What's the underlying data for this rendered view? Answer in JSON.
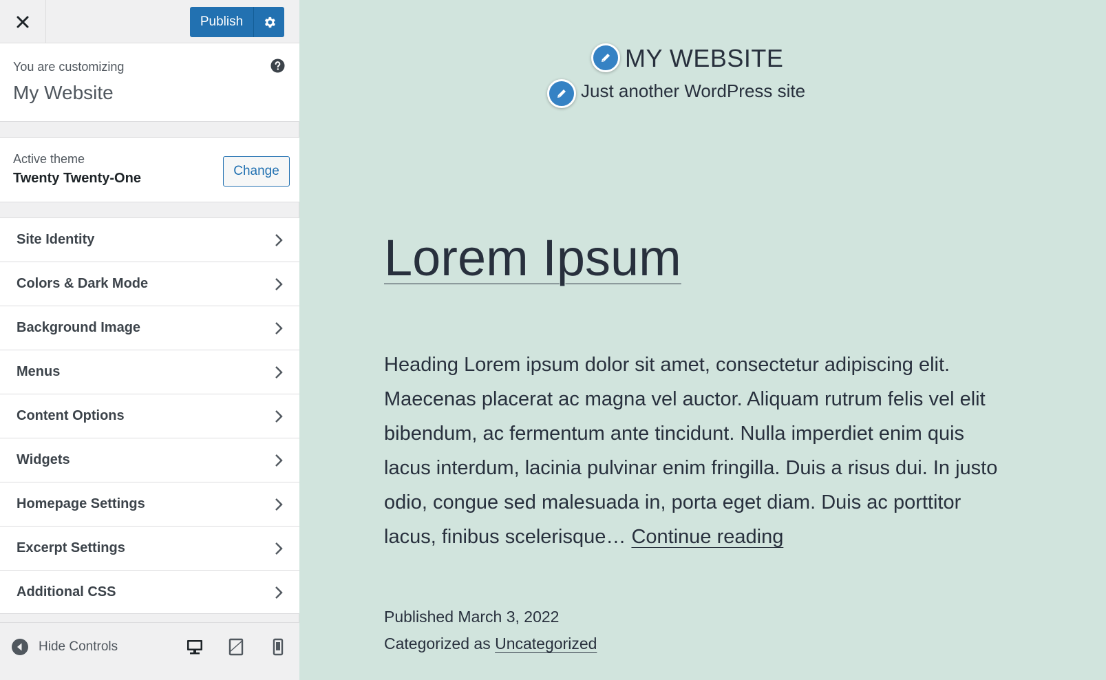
{
  "sidebar": {
    "close_label": "Close",
    "publish_label": "Publish",
    "customizing_label": "You are customizing",
    "site_name": "My Website",
    "active_theme_label": "Active theme",
    "theme_name": "Twenty Twenty-One",
    "change_label": "Change",
    "sections": [
      {
        "label": "Site Identity"
      },
      {
        "label": "Colors & Dark Mode"
      },
      {
        "label": "Background Image"
      },
      {
        "label": "Menus"
      },
      {
        "label": "Content Options"
      },
      {
        "label": "Widgets"
      },
      {
        "label": "Homepage Settings"
      },
      {
        "label": "Excerpt Settings"
      },
      {
        "label": "Additional CSS"
      }
    ],
    "hide_controls_label": "Hide Controls",
    "devices": [
      "desktop-icon",
      "tablet-icon",
      "mobile-icon"
    ]
  },
  "preview": {
    "site_title": "MY WEBSITE",
    "tagline": "Just another WordPress site",
    "post_title": "Lorem Ipsum",
    "excerpt": "Heading Lorem ipsum dolor sit amet, consectetur adipiscing elit. Maecenas placerat ac magna vel auctor. Aliquam rutrum felis vel elit bibendum, ac fermentum ante tincidunt. Nulla imperdiet enim quis lacus interdum, lacinia pulvinar enim fringilla. Duis a risus dui. In justo odio, congue sed malesuada in, porta eget diam. Duis ac porttitor lacus, finibus scelerisque…",
    "continue_reading": "Continue reading",
    "published_label": "Published March 3, 2022",
    "categorized_label": "Categorized as",
    "category": "Uncategorized"
  },
  "colors": {
    "accent": "#2271b1",
    "preview_bg": "#d1e4dd",
    "pencil_bg": "#3582c4"
  }
}
